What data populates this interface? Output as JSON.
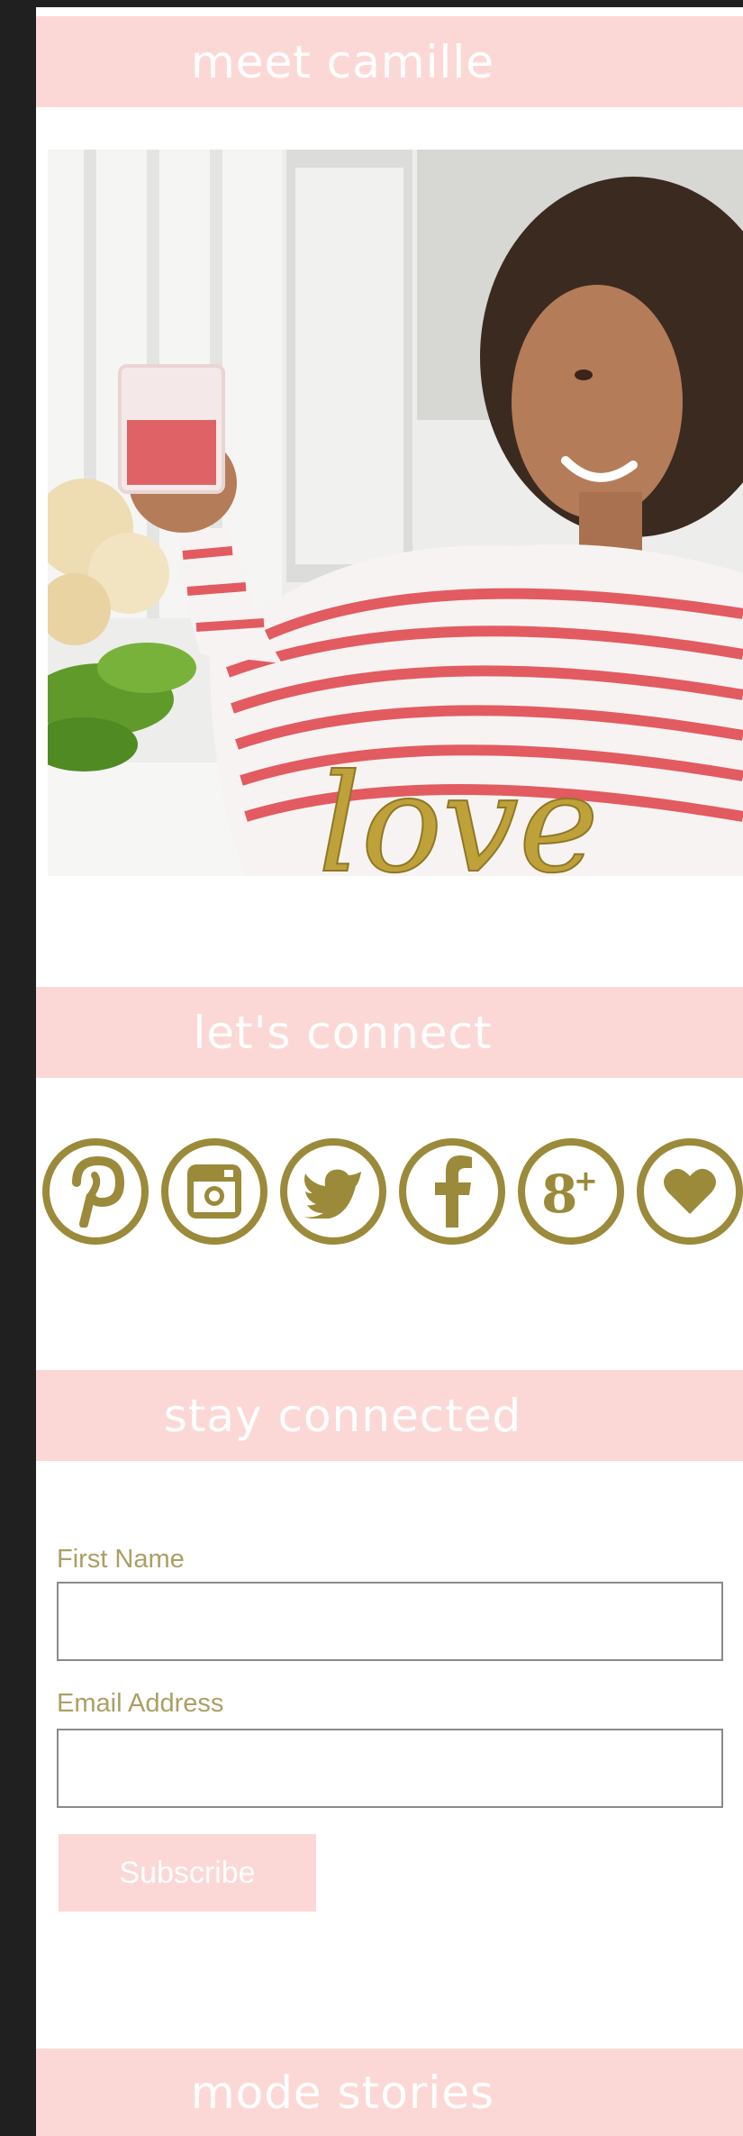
{
  "sections": {
    "meet": {
      "title": "meet camille"
    },
    "connect": {
      "title": "let's connect"
    },
    "stay": {
      "title": "stay connected"
    },
    "mode": {
      "title": "mode stories"
    }
  },
  "hero": {
    "alt": "Camille holding a glass at a table",
    "signature": "love"
  },
  "social": {
    "color": "#9a8a3a",
    "icons": [
      "pinterest-icon",
      "instagram-icon",
      "twitter-icon",
      "facebook-icon",
      "google-plus-icon",
      "heart-icon"
    ]
  },
  "newsletter": {
    "first_name_label": "First Name",
    "first_name_value": "",
    "email_label": "Email Address",
    "email_value": "",
    "subscribe_label": "Subscribe"
  },
  "colors": {
    "accent_pink": "#fbd8d6",
    "gold": "#9a8a3a",
    "label_gold": "#ac9f63",
    "background": "#202020"
  }
}
